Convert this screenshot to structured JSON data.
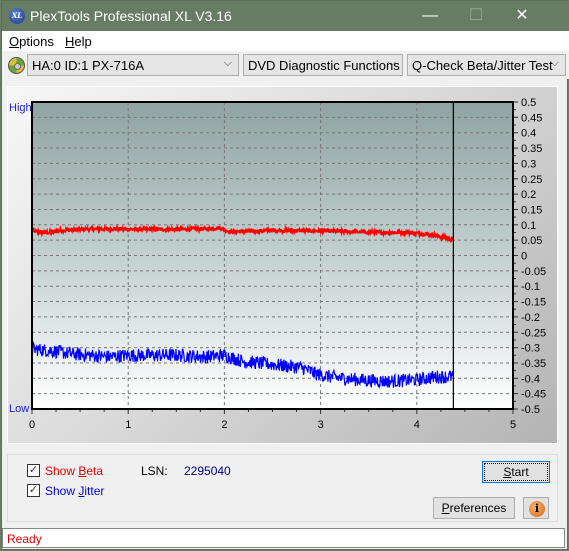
{
  "window": {
    "title": "PlexTools Professional XL V3.16",
    "icon_text": "XL",
    "minimize": "—",
    "maximize": "☐",
    "close": "✕"
  },
  "menu": [
    {
      "label": "Options",
      "accel": "O"
    },
    {
      "label": "Help",
      "accel": "H"
    }
  ],
  "toolbar": {
    "drive": "HA:0 ID:1  PX-716A",
    "function": "DVD Diagnostic Functions",
    "test": "Q-Check Beta/Jitter Test",
    "chevron": "⌵"
  },
  "controls": {
    "show_beta": {
      "label_pre": "Show ",
      "label_accel": "B",
      "label_post": "eta",
      "checked": true,
      "color": "#e00000"
    },
    "show_jitter": {
      "label_pre": "Show ",
      "label_accel": "J",
      "label_post": "itter",
      "checked": true,
      "color": "#0000e0"
    },
    "lsn_label": "LSN:",
    "lsn_value": "2295040",
    "start": {
      "accel": "S",
      "rest": "tart"
    },
    "preferences": {
      "accel": "P",
      "rest": "references"
    },
    "info_glyph": "i",
    "check_glyph": "✓"
  },
  "status": "Ready",
  "chart_data": {
    "type": "line",
    "title": "",
    "xlabel": "",
    "ylabel": "",
    "left_labels": {
      "top": "High",
      "bottom": "Low"
    },
    "xlim": [
      0,
      5
    ],
    "ylim": [
      -0.5,
      0.5
    ],
    "x_ticks": [
      "0",
      "1",
      "2",
      "3",
      "4",
      "5"
    ],
    "y_ticks": [
      "0.5",
      "0.45",
      "0.4",
      "0.35",
      "0.3",
      "0.25",
      "0.2",
      "0.15",
      "0.1",
      "0.05",
      "0",
      "-0.05",
      "-0.1",
      "-0.15",
      "-0.2",
      "-0.25",
      "-0.3",
      "-0.35",
      "-0.4",
      "-0.45",
      "-0.5"
    ],
    "grid": true,
    "marker_x": 4.38,
    "series": [
      {
        "name": "Beta",
        "color": "#ff0000",
        "x": [
          0,
          0.1,
          0.2,
          0.3,
          0.5,
          0.8,
          1.0,
          1.2,
          1.5,
          1.8,
          1.95,
          2.0,
          2.05,
          2.2,
          2.5,
          3.0,
          3.3,
          3.6,
          3.9,
          4.1,
          4.2,
          4.3,
          4.38
        ],
        "values": [
          0.08,
          0.075,
          0.075,
          0.082,
          0.085,
          0.087,
          0.086,
          0.085,
          0.085,
          0.087,
          0.09,
          0.085,
          0.078,
          0.078,
          0.082,
          0.08,
          0.078,
          0.075,
          0.075,
          0.07,
          0.065,
          0.058,
          0.05
        ],
        "noise": 0.006
      },
      {
        "name": "Jitter",
        "color": "#0000ff",
        "x": [
          0,
          0.2,
          0.4,
          0.6,
          0.8,
          1.0,
          1.2,
          1.5,
          1.8,
          2.0,
          2.2,
          2.5,
          2.8,
          2.95,
          3.1,
          3.4,
          3.7,
          4.0,
          4.2,
          4.38
        ],
        "values": [
          -0.305,
          -0.31,
          -0.32,
          -0.325,
          -0.33,
          -0.325,
          -0.325,
          -0.325,
          -0.33,
          -0.325,
          -0.345,
          -0.355,
          -0.365,
          -0.385,
          -0.395,
          -0.405,
          -0.41,
          -0.405,
          -0.395,
          -0.395
        ],
        "noise": 0.022
      }
    ]
  }
}
